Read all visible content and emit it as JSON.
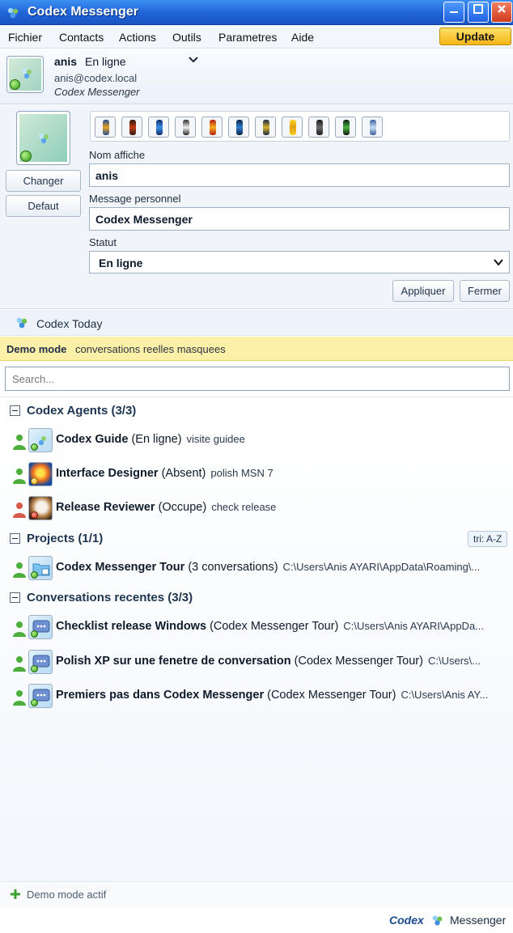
{
  "window": {
    "title": "Codex Messenger"
  },
  "menu": {
    "items": [
      "Fichier",
      "Contacts",
      "Actions",
      "Outils",
      "Parametres",
      "Aide"
    ],
    "update_label": "Update"
  },
  "profile": {
    "name": "anis",
    "status": "En ligne",
    "email": "anis@codex.local",
    "app": "Codex Messenger"
  },
  "editor": {
    "change_label": "Changer",
    "default_label": "Defaut",
    "display_name_label": "Nom affiche",
    "display_name_value": "anis",
    "personal_message_label": "Message personnel",
    "personal_message_value": "Codex Messenger",
    "status_label": "Statut",
    "status_value": "En ligne",
    "apply_label": "Appliquer",
    "close_label": "Fermer"
  },
  "today": {
    "label": "Codex Today"
  },
  "demo": {
    "tag": "Demo mode",
    "text": "conversations reelles masquees"
  },
  "search": {
    "placeholder": "Search..."
  },
  "groups": [
    {
      "title": "Codex Agents (3/3)",
      "rows": [
        {
          "name": "Codex Guide",
          "paren": "(En ligne)",
          "sub": "visite guidee",
          "presence": "online",
          "icon": "app-icon"
        },
        {
          "name": "Interface Designer",
          "paren": "(Absent)",
          "sub": "polish MSN 7",
          "presence": "online",
          "icon": "flower-icon"
        },
        {
          "name": "Release Reviewer",
          "paren": "(Occupe)",
          "sub": "check release",
          "presence": "busy",
          "icon": "dog-icon"
        }
      ]
    },
    {
      "title": "Projects (1/1)",
      "sort": "tri: A-Z",
      "rows": [
        {
          "name": "Codex Messenger Tour",
          "paren": "(3 conversations)",
          "sub": "C:\\Users\\Anis AYARI\\AppData\\Roaming\\...",
          "presence": "online",
          "icon": "folder-icon"
        }
      ]
    },
    {
      "title": "Conversations recentes (3/3)",
      "rows": [
        {
          "name": "Checklist release Windows",
          "paren": "(Codex Messenger Tour)",
          "sub": "C:\\Users\\Anis AYARI\\AppDa...",
          "presence": "online",
          "icon": "chat-icon"
        },
        {
          "name": "Polish XP sur une fenetre de conversation",
          "paren": "(Codex Messenger Tour)",
          "sub": "C:\\Users\\...",
          "presence": "online",
          "icon": "chat-icon"
        },
        {
          "name": "Premiers pas dans Codex Messenger",
          "paren": "(Codex Messenger Tour)",
          "sub": "C:\\Users\\Anis AY...",
          "presence": "online",
          "icon": "chat-icon"
        }
      ]
    }
  ],
  "footer": {
    "label": "Demo mode actif"
  },
  "brand": {
    "a": "Codex",
    "b": "Messenger"
  },
  "colors": {
    "title_bar": "#1f63d6",
    "online": "#4caf3b",
    "busy": "#d65a4a",
    "demo_bg": "#fdf0a8",
    "update": "#f3b415"
  }
}
